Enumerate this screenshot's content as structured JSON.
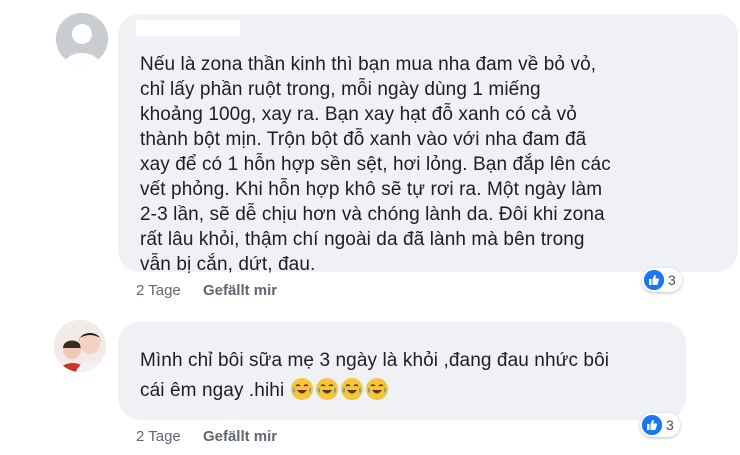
{
  "comments": [
    {
      "lines": [
        "Nếu là zona thần kinh thì bạn mua nha đam về bỏ vỏ,",
        "chỉ lấy phần ruột trong, mỗi ngày dùng 1 miếng",
        "khoảng 100g, xay ra. Bạn xay hạt đỗ xanh có cả vỏ",
        "thành bột mịn. Trộn bột đỗ xanh vào với nha đam đã",
        "xay để có 1 hỗn hợp sền sệt, hơi lỏng. Bạn đắp lên các",
        "vết phỏng. Khi hỗn hợp khô sẽ tự rơi ra. Một ngày làm",
        "2-3 lần, sẽ dễ chịu hơn và chóng lành da. Đôi khi zona",
        "rất lâu khỏi, thậm chí ngoài da đã lành mà bên trong",
        "vẫn bị cắn, dứt, đau."
      ],
      "time": "2 Tage",
      "like_label": "Gefällt mir",
      "reaction_count": "3"
    },
    {
      "lines": [
        "Mình chỉ bôi sữa mẹ 3 ngày là khỏi ,đang đau nhức bôi",
        "cái êm ngay .hihi"
      ],
      "emoji_count": 4,
      "time": "2 Tage",
      "like_label": "Gefällt mir",
      "reaction_count": "3"
    }
  ],
  "icons": {
    "avatar_placeholder": "default-avatar-icon",
    "like": "like-thumb-icon",
    "emoji": "tears-of-joy-emoji-icon"
  },
  "colors": {
    "bubble": "#f0f1f4",
    "text": "#1c1e21",
    "meta": "#606770",
    "like_blue": "#1877f2"
  }
}
